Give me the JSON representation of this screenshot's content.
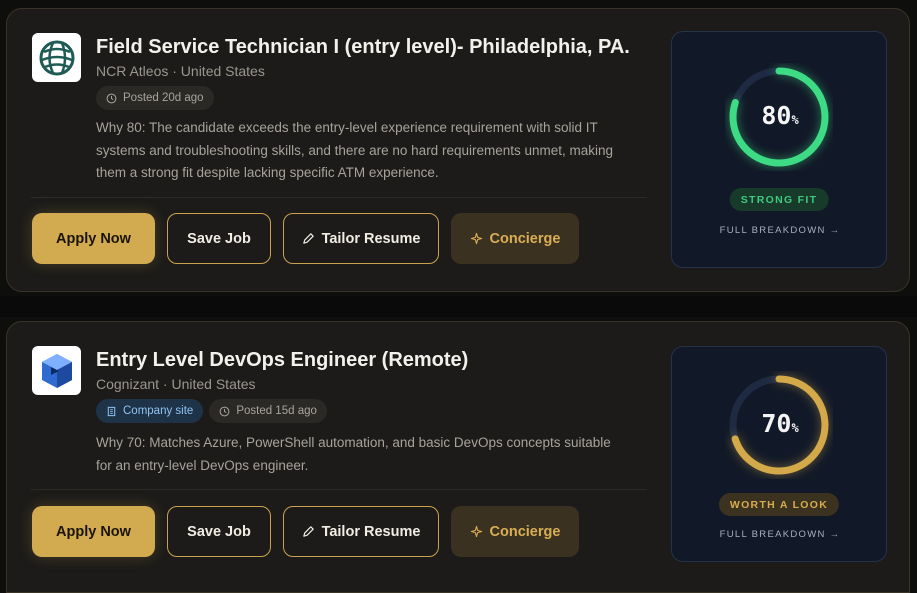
{
  "jobs": [
    {
      "logo": "globe-logo",
      "title": "Field Service Technician I (entry level)- Philadelphia, PA.",
      "company": "NCR Atleos · United States",
      "posted": "Posted 20d ago",
      "why_lines": [
        "Why 80: The candidate exceeds the entry-level experience requirement with solid IT",
        "systems and troubleshooting skills, and there are no hard requirements unmet, making",
        "them a strong fit despite lacking specific ATM experience."
      ],
      "actions": {
        "apply": "Apply Now",
        "save": "Save Job",
        "tailor": "Tailor Resume",
        "concierge": "Concierge"
      },
      "score": {
        "value": "80",
        "unit": "%",
        "fraction": 0.8,
        "badge": "STRONG FIT",
        "breakdown": "FULL BREAKDOWN →",
        "color": "#3ddc84"
      }
    },
    {
      "logo": "cube-logo",
      "title": "Entry Level DevOps Engineer (Remote)",
      "company": "Cognizant · United States",
      "company_site": "Company site",
      "posted": "Posted 15d ago",
      "why_lines": [
        "Why 70: Matches Azure, PowerShell automation, and basic DevOps concepts suitable",
        "for an entry-level DevOps engineer."
      ],
      "actions": {
        "apply": "Apply Now",
        "save": "Save Job",
        "tailor": "Tailor Resume",
        "concierge": "Concierge"
      },
      "score": {
        "value": "70",
        "unit": "%",
        "fraction": 0.7,
        "badge": "WORTH A LOOK",
        "breakdown": "FULL BREAKDOWN →",
        "color": "#d4a94a"
      }
    }
  ],
  "colors": {
    "accent": "#d2aa4f",
    "strong": "#3ddc84",
    "worth": "#d4a94a",
    "ring_track": "#1e2a42"
  }
}
